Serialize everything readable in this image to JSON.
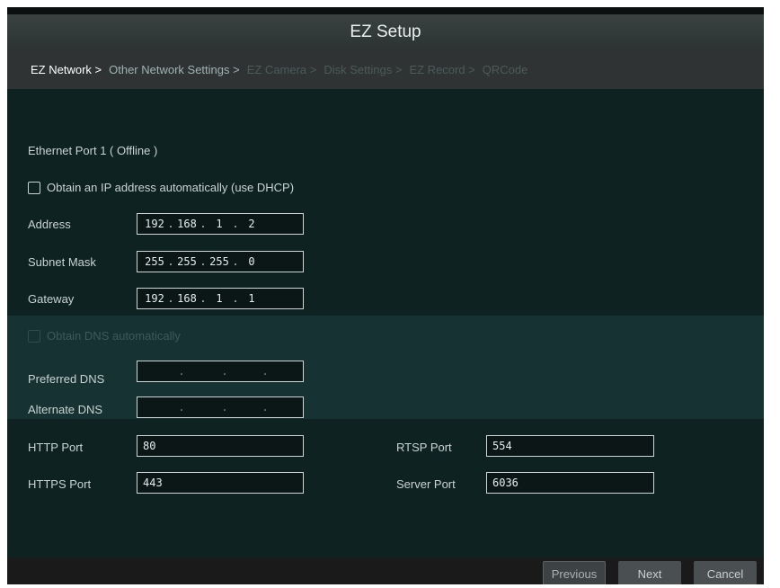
{
  "window": {
    "title": "EZ Setup"
  },
  "breadcrumbs": [
    {
      "label": "EZ Network >",
      "state": "active"
    },
    {
      "label": "Other Network Settings >",
      "state": "next"
    },
    {
      "label": "EZ Camera >",
      "state": "disabled"
    },
    {
      "label": "Disk Settings >",
      "state": "disabled"
    },
    {
      "label": "EZ Record >",
      "state": "disabled"
    },
    {
      "label": "QRCode",
      "state": "disabled"
    }
  ],
  "port": {
    "label": "Ethernet Port 1 ( Offline )"
  },
  "dhcp": {
    "label": "Obtain an IP address automatically (use DHCP)",
    "checked": false
  },
  "address": {
    "label": "Address",
    "octets": [
      "192",
      "168",
      "1",
      "2"
    ]
  },
  "subnet": {
    "label": "Subnet Mask",
    "octets": [
      "255",
      "255",
      "255",
      "0"
    ]
  },
  "gateway": {
    "label": "Gateway",
    "octets": [
      "192",
      "168",
      "1",
      "1"
    ]
  },
  "dns_auto": {
    "label": "Obtain DNS automatically",
    "checked": false,
    "enabled": false
  },
  "preferred_dns": {
    "label": "Preferred DNS",
    "octets": [
      "",
      "",
      "",
      ""
    ]
  },
  "alternate_dns": {
    "label": "Alternate DNS",
    "octets": [
      "",
      "",
      "",
      ""
    ]
  },
  "http_port": {
    "label": "HTTP Port",
    "value": "80"
  },
  "https_port": {
    "label": "HTTPS Port",
    "value": "443"
  },
  "rtsp_port": {
    "label": "RTSP Port",
    "value": "554"
  },
  "server_port": {
    "label": "Server Port",
    "value": "6036"
  },
  "buttons": {
    "previous": "Previous",
    "next": "Next",
    "cancel": "Cancel"
  },
  "colors": {
    "background": "#0f2222",
    "dns_band": "#163232",
    "breadcrumb_bar": "#2f3333",
    "text": "#c9d3d3"
  }
}
